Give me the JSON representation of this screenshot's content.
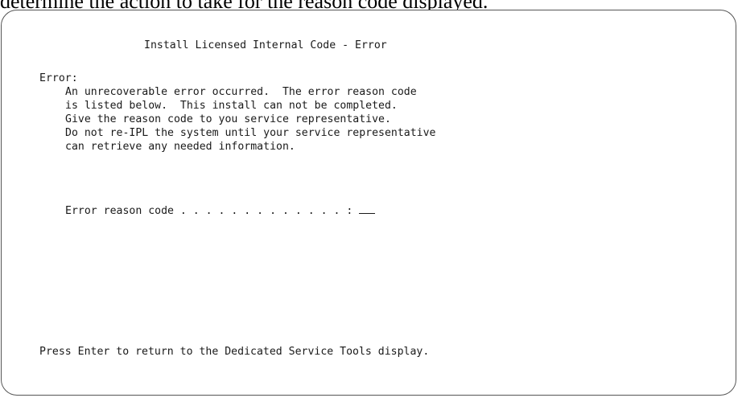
{
  "caption_fragment": "determine the action to take for the reason code displayed.",
  "screen": {
    "title": "Install Licensed Internal Code - Error",
    "error_label": "Error:",
    "error_lines": [
      "An unrecoverable error occurred.  The error reason code",
      "is listed below.  This install can not be completed.",
      "Give the reason code to you service representative.",
      "Do not re-IPL the system until your service representative",
      "can retrieve any needed information."
    ],
    "reason_code_label": "Error reason code . . . . . . . . . . . . . :",
    "reason_code_value": "",
    "instruction": "Press Enter to return to the Dedicated Service Tools display."
  },
  "colors": {
    "frame_border": "#555555",
    "text": "#1a1a1a",
    "background": "#ffffff"
  }
}
